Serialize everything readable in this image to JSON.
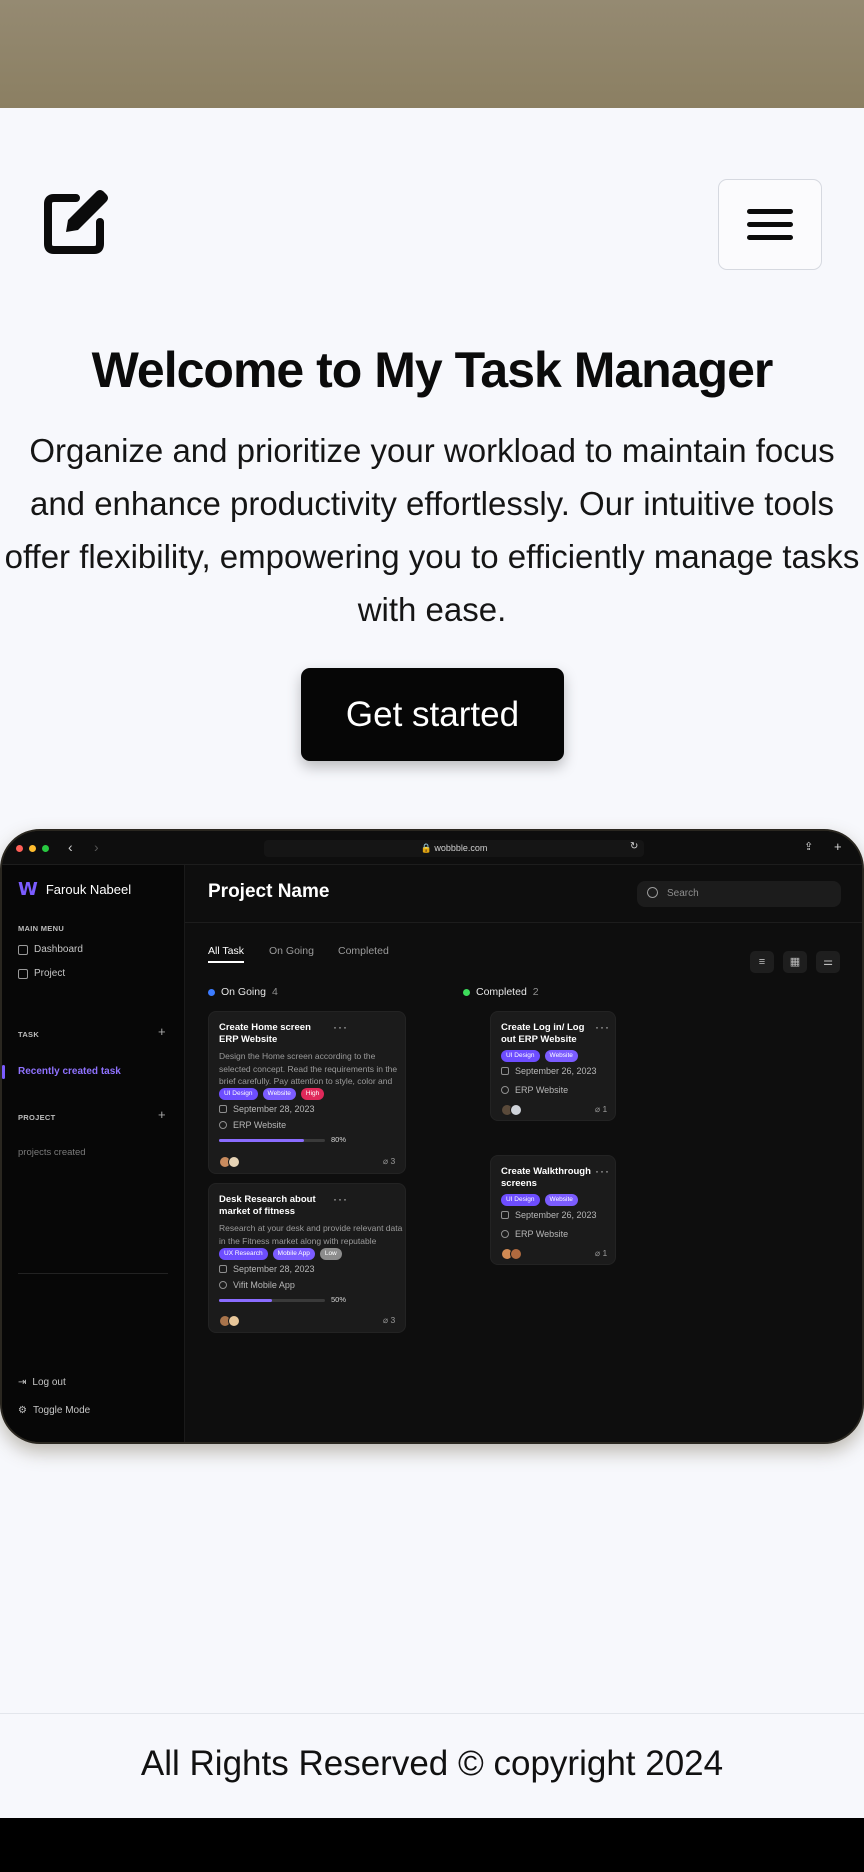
{
  "header": {
    "logo_icon": "edit-square-icon",
    "menu_icon": "hamburger-menu-icon"
  },
  "hero": {
    "title": "Welcome to My Task Manager",
    "description": "Organize and prioritize your workload to maintain focus and enhance productivity effortlessly. Our intuitive tools offer flexibility, empowering you to efficiently manage tasks with ease.",
    "cta_label": "Get started"
  },
  "mockup": {
    "url": "wobbble.com",
    "brand": "Farouk Nabeel",
    "main_menu_label": "MAIN MENU",
    "menu_items": [
      "Dashboard",
      "Project"
    ],
    "task_section": "TASK",
    "task_active": "Recently created task",
    "project_section": "PROJECT",
    "project_muted": "projects created",
    "logout": "Log out",
    "toggle_mode": "Toggle Mode",
    "project_title": "Project Name",
    "search_placeholder": "Search",
    "tabs": [
      "All Task",
      "On Going",
      "Completed"
    ],
    "columns": [
      {
        "name": "On Going",
        "count": "4",
        "color": "#3b7bff"
      },
      {
        "name": "Completed",
        "count": "2",
        "color": "#3ddc5a"
      }
    ],
    "cards": [
      {
        "title": "Create Home screen ERP Website",
        "description": "Design the Home screen according to the selected concept. Read the requirements in the brief carefully. Pay attention to style, color and font.",
        "tags": [
          {
            "label": "UI Design",
            "color": "#6d4dff"
          },
          {
            "label": "Website",
            "color": "#7b5cff"
          },
          {
            "label": "High",
            "color": "#e0295a"
          }
        ],
        "date": "September 28, 2023",
        "project": "ERP Website",
        "progress": 80,
        "progress_label": "80%",
        "attachments": "3"
      },
      {
        "title": "Desk Research about market of fitness",
        "description": "Research at your desk and provide relevant data in the Fitness market along with reputable sources",
        "tags": [
          {
            "label": "UX Research",
            "color": "#6d4dff"
          },
          {
            "label": "Mobile App",
            "color": "#7b5cff"
          },
          {
            "label": "Low",
            "color": "#8c8c8c"
          }
        ],
        "date": "September 28, 2023",
        "project": "Vifit Mobile App",
        "progress": 50,
        "progress_label": "50%",
        "attachments": "3"
      },
      {
        "title": "Create Log in/ Log out ERP Website",
        "tags": [
          {
            "label": "UI Design",
            "color": "#6d4dff"
          },
          {
            "label": "Website",
            "color": "#7b5cff"
          }
        ],
        "date": "September 26, 2023",
        "project": "ERP Website",
        "attachments": "1"
      },
      {
        "title": "Create Walkthrough screens",
        "tags": [
          {
            "label": "UI Design",
            "color": "#6d4dff"
          },
          {
            "label": "Website",
            "color": "#7b5cff"
          }
        ],
        "date": "September 26, 2023",
        "project": "ERP Website",
        "attachments": "1"
      }
    ]
  },
  "footer": {
    "text": "All Rights Reserved © copyright 2024"
  }
}
